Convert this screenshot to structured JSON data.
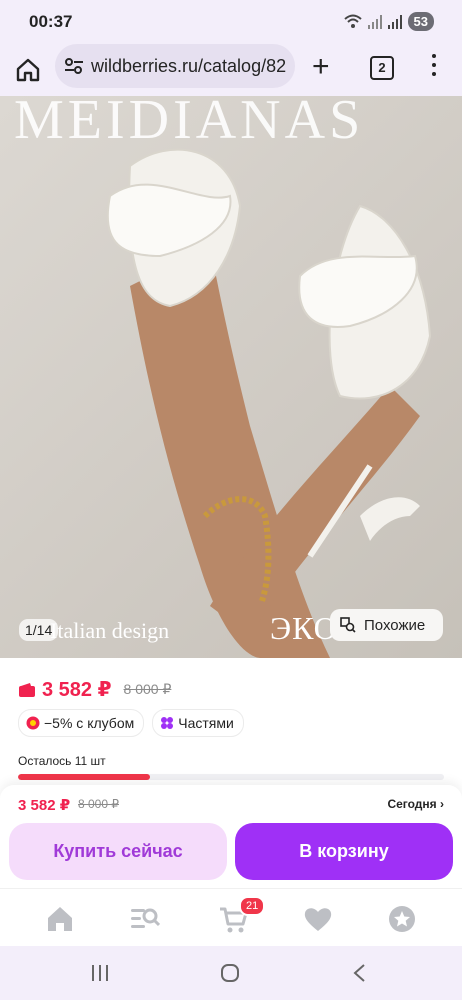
{
  "status_bar": {
    "time": "00:37",
    "battery": "53"
  },
  "browser": {
    "url": "wildberries.ru/catalog/82",
    "tab_count": "2"
  },
  "photo": {
    "watermark": "MEIDIANAS",
    "counter": "1/14",
    "caption_left": "Italian design",
    "caption_right": "ЭКОКОЖА",
    "similar_label": "Похожие"
  },
  "product": {
    "price": "3 582 ₽",
    "old_price": "8 000 ₽",
    "chips": [
      {
        "label": "−5% с клубом",
        "icon": "club-discount-icon"
      },
      {
        "label": "Частями",
        "icon": "installments-icon"
      }
    ],
    "stock_label": "Осталось 11 шт",
    "stock_fraction": 0.31
  },
  "buy_panel": {
    "price": "3 582 ₽",
    "old_price": "8 000 ₽",
    "delivery": "Сегодня",
    "buy_now": "Купить сейчас",
    "add_to_cart": "В корзину"
  },
  "tabs": [
    {
      "name": "home",
      "icon": "home-icon"
    },
    {
      "name": "catalog",
      "icon": "catalog-search-icon"
    },
    {
      "name": "cart",
      "icon": "cart-icon",
      "badge": "21"
    },
    {
      "name": "favorites",
      "icon": "heart-icon"
    },
    {
      "name": "profile",
      "icon": "star-icon"
    }
  ],
  "colors": {
    "accent": "#9f30f6",
    "price": "#f0224f",
    "buy_now_bg": "#f5dcfb"
  }
}
